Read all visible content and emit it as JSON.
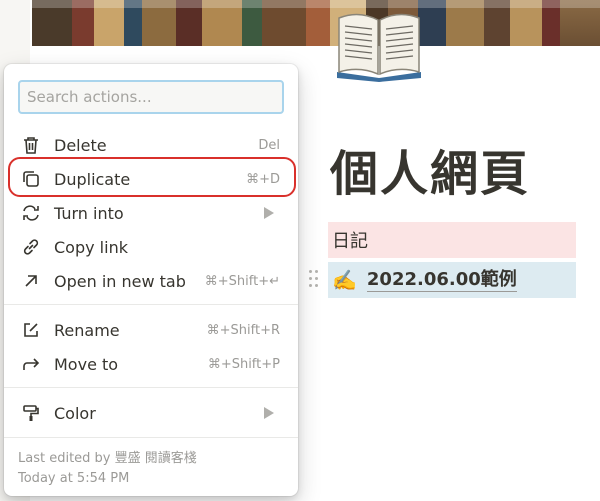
{
  "page": {
    "title": "個人網頁",
    "blocks": [
      {
        "text": "日記"
      },
      {
        "emoji": "✍️",
        "text": "2022.06.00範例"
      }
    ]
  },
  "menu": {
    "search_placeholder": "Search actions...",
    "items": [
      {
        "label": "Delete",
        "shortcut": "Del",
        "icon": "trash-icon"
      },
      {
        "label": "Duplicate",
        "shortcut": "⌘+D",
        "icon": "duplicate-icon"
      },
      {
        "label": "Turn into",
        "shortcut": "",
        "icon": "turn-into-icon"
      },
      {
        "label": "Copy link",
        "shortcut": "",
        "icon": "link-icon"
      },
      {
        "label": "Open in new tab",
        "shortcut": "⌘+Shift+↵",
        "icon": "external-arrow-icon"
      },
      {
        "label": "Rename",
        "shortcut": "⌘+Shift+R",
        "icon": "rename-icon"
      },
      {
        "label": "Move to",
        "shortcut": "⌘+Shift+P",
        "icon": "move-arrow-icon"
      },
      {
        "label": "Color",
        "shortcut": "",
        "icon": "paint-roller-icon"
      }
    ],
    "footer": {
      "edited_by": "Last edited by 豐盛 閱讀客棧",
      "edited_time": "Today at 5:54 PM"
    }
  },
  "colors": {
    "highlight": "#d9302b",
    "search_focus": "#a9d4ec",
    "pink_block": "#fbe4e4",
    "blue_block": "#ddebf1"
  }
}
